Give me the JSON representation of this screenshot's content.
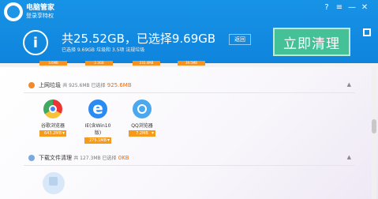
{
  "header": {
    "title": "电脑管家",
    "login_text": "登录享特权",
    "summary": "共25.52GB，已选择9.69GB",
    "back_button": "返回",
    "detail_text": "已选择 9.69GB 垃圾和 3.5项 法规垃圾",
    "clean_button": "立即清理",
    "window_controls": [
      "?",
      "≡",
      "—",
      "✕"
    ]
  },
  "top_pills": [
    "3.6MB",
    "2.3GB",
    "233.4MB",
    "39.5MB"
  ],
  "internet_section": {
    "title": "上网垃圾",
    "total": "共 925.6MB 已选择",
    "selected": "925.6MB",
    "apps": [
      {
        "name": "谷歌浏览器",
        "size": "643.2MB"
      },
      {
        "name": "IE(含Win10版)",
        "size": "275.1MB"
      },
      {
        "name": "QQ浏览器",
        "size": "7.2MB"
      }
    ]
  },
  "download_section": {
    "title": "下载文件清理",
    "total": "共 127.3MB 已选择",
    "selected": "0KB"
  }
}
